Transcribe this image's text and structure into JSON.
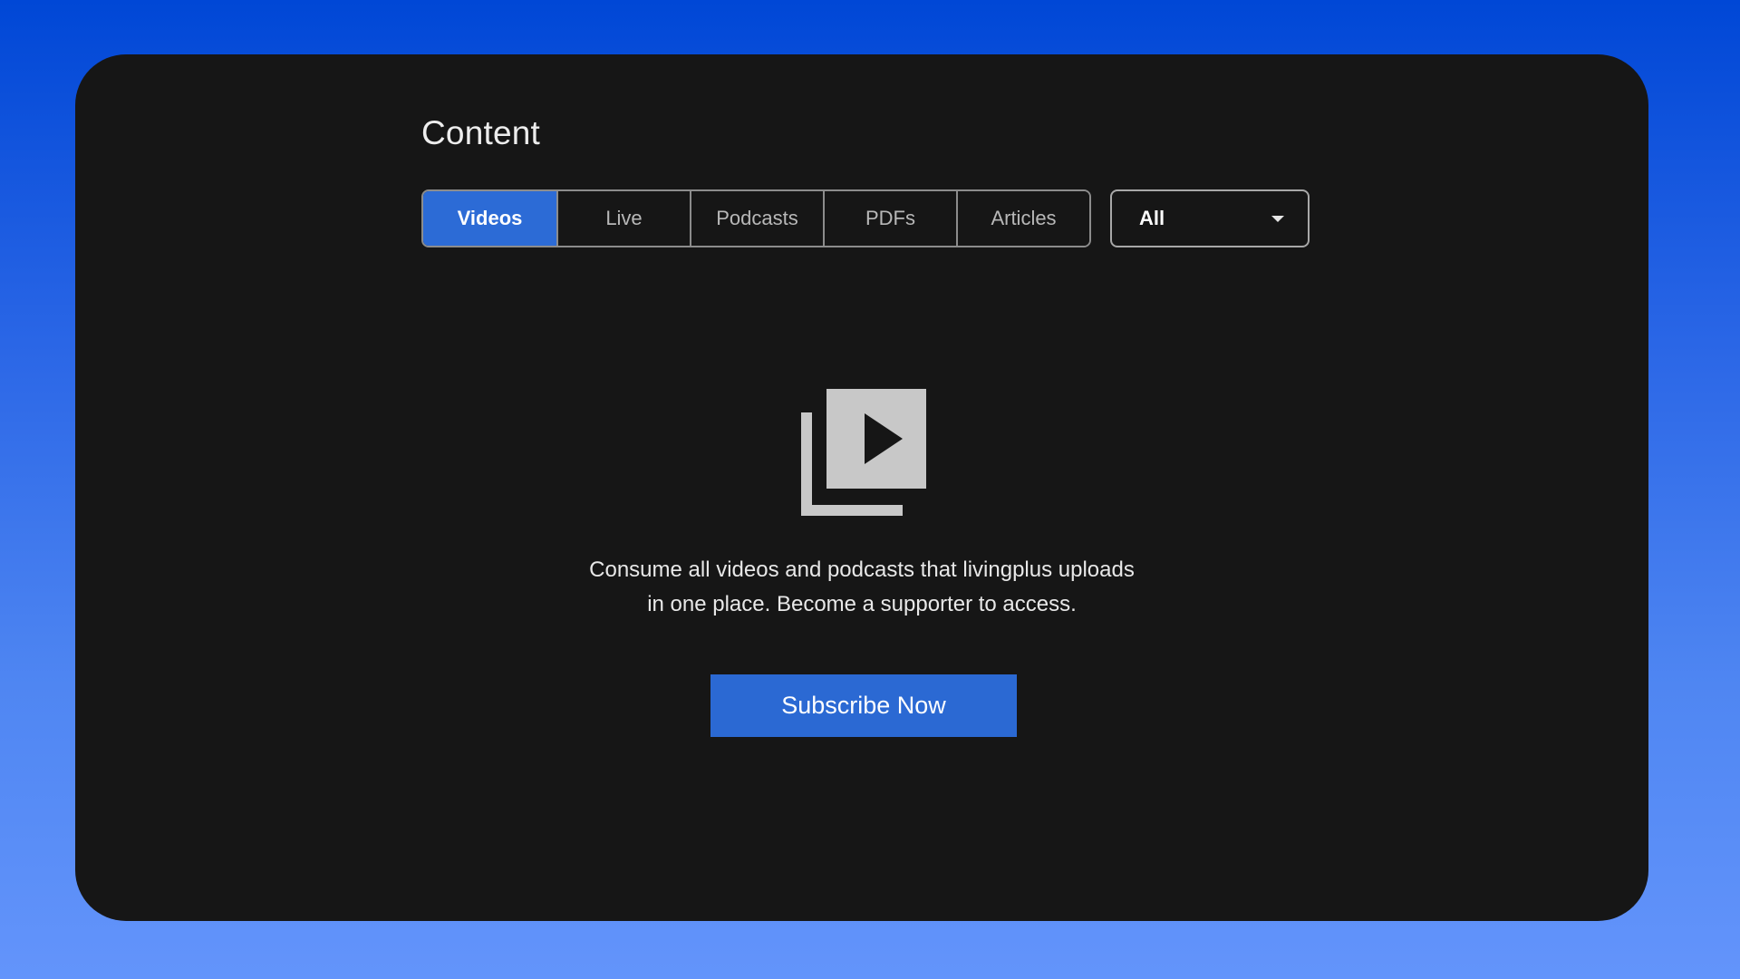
{
  "page": {
    "title": "Content"
  },
  "tabs": [
    {
      "label": "Videos",
      "active": true
    },
    {
      "label": "Live",
      "active": false
    },
    {
      "label": "Podcasts",
      "active": false
    },
    {
      "label": "PDFs",
      "active": false
    },
    {
      "label": "Articles",
      "active": false
    }
  ],
  "filter": {
    "selected": "All",
    "icon": "caret-down-icon"
  },
  "empty_state": {
    "icon": "video-library-icon",
    "line1": "Consume all videos and podcasts that livingplus uploads",
    "line2": "in one place. Become a supporter to access."
  },
  "subscribe": {
    "label": "Subscribe Now"
  },
  "colors": {
    "accent": "#2c6bd6",
    "panel": "#161616",
    "background_top": "#0047d6",
    "background_bottom": "#6394fb",
    "icon": "#c8c8c8"
  }
}
